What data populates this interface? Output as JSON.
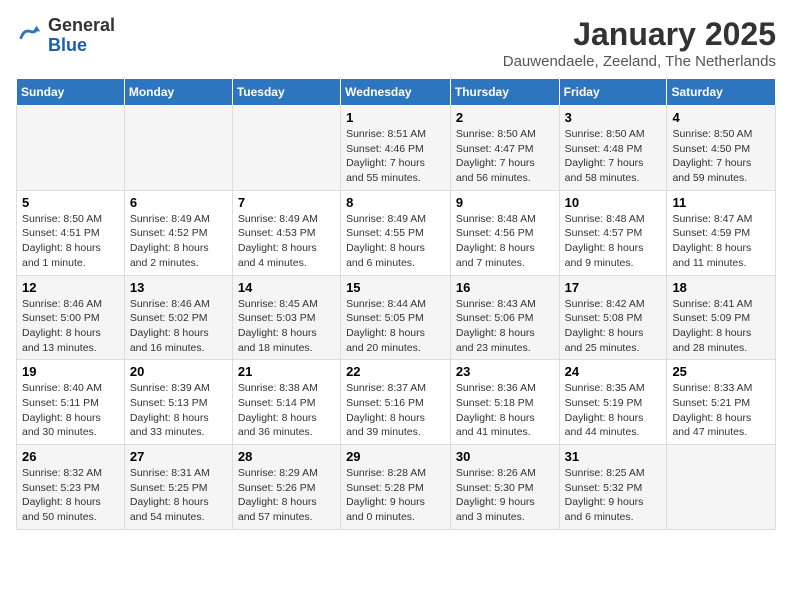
{
  "logo": {
    "general": "General",
    "blue": "Blue"
  },
  "title": "January 2025",
  "subtitle": "Dauwendaele, Zeeland, The Netherlands",
  "days_of_week": [
    "Sunday",
    "Monday",
    "Tuesday",
    "Wednesday",
    "Thursday",
    "Friday",
    "Saturday"
  ],
  "weeks": [
    [
      {
        "num": "",
        "text": ""
      },
      {
        "num": "",
        "text": ""
      },
      {
        "num": "",
        "text": ""
      },
      {
        "num": "1",
        "text": "Sunrise: 8:51 AM\nSunset: 4:46 PM\nDaylight: 7 hours and 55 minutes."
      },
      {
        "num": "2",
        "text": "Sunrise: 8:50 AM\nSunset: 4:47 PM\nDaylight: 7 hours and 56 minutes."
      },
      {
        "num": "3",
        "text": "Sunrise: 8:50 AM\nSunset: 4:48 PM\nDaylight: 7 hours and 58 minutes."
      },
      {
        "num": "4",
        "text": "Sunrise: 8:50 AM\nSunset: 4:50 PM\nDaylight: 7 hours and 59 minutes."
      }
    ],
    [
      {
        "num": "5",
        "text": "Sunrise: 8:50 AM\nSunset: 4:51 PM\nDaylight: 8 hours and 1 minute."
      },
      {
        "num": "6",
        "text": "Sunrise: 8:49 AM\nSunset: 4:52 PM\nDaylight: 8 hours and 2 minutes."
      },
      {
        "num": "7",
        "text": "Sunrise: 8:49 AM\nSunset: 4:53 PM\nDaylight: 8 hours and 4 minutes."
      },
      {
        "num": "8",
        "text": "Sunrise: 8:49 AM\nSunset: 4:55 PM\nDaylight: 8 hours and 6 minutes."
      },
      {
        "num": "9",
        "text": "Sunrise: 8:48 AM\nSunset: 4:56 PM\nDaylight: 8 hours and 7 minutes."
      },
      {
        "num": "10",
        "text": "Sunrise: 8:48 AM\nSunset: 4:57 PM\nDaylight: 8 hours and 9 minutes."
      },
      {
        "num": "11",
        "text": "Sunrise: 8:47 AM\nSunset: 4:59 PM\nDaylight: 8 hours and 11 minutes."
      }
    ],
    [
      {
        "num": "12",
        "text": "Sunrise: 8:46 AM\nSunset: 5:00 PM\nDaylight: 8 hours and 13 minutes."
      },
      {
        "num": "13",
        "text": "Sunrise: 8:46 AM\nSunset: 5:02 PM\nDaylight: 8 hours and 16 minutes."
      },
      {
        "num": "14",
        "text": "Sunrise: 8:45 AM\nSunset: 5:03 PM\nDaylight: 8 hours and 18 minutes."
      },
      {
        "num": "15",
        "text": "Sunrise: 8:44 AM\nSunset: 5:05 PM\nDaylight: 8 hours and 20 minutes."
      },
      {
        "num": "16",
        "text": "Sunrise: 8:43 AM\nSunset: 5:06 PM\nDaylight: 8 hours and 23 minutes."
      },
      {
        "num": "17",
        "text": "Sunrise: 8:42 AM\nSunset: 5:08 PM\nDaylight: 8 hours and 25 minutes."
      },
      {
        "num": "18",
        "text": "Sunrise: 8:41 AM\nSunset: 5:09 PM\nDaylight: 8 hours and 28 minutes."
      }
    ],
    [
      {
        "num": "19",
        "text": "Sunrise: 8:40 AM\nSunset: 5:11 PM\nDaylight: 8 hours and 30 minutes."
      },
      {
        "num": "20",
        "text": "Sunrise: 8:39 AM\nSunset: 5:13 PM\nDaylight: 8 hours and 33 minutes."
      },
      {
        "num": "21",
        "text": "Sunrise: 8:38 AM\nSunset: 5:14 PM\nDaylight: 8 hours and 36 minutes."
      },
      {
        "num": "22",
        "text": "Sunrise: 8:37 AM\nSunset: 5:16 PM\nDaylight: 8 hours and 39 minutes."
      },
      {
        "num": "23",
        "text": "Sunrise: 8:36 AM\nSunset: 5:18 PM\nDaylight: 8 hours and 41 minutes."
      },
      {
        "num": "24",
        "text": "Sunrise: 8:35 AM\nSunset: 5:19 PM\nDaylight: 8 hours and 44 minutes."
      },
      {
        "num": "25",
        "text": "Sunrise: 8:33 AM\nSunset: 5:21 PM\nDaylight: 8 hours and 47 minutes."
      }
    ],
    [
      {
        "num": "26",
        "text": "Sunrise: 8:32 AM\nSunset: 5:23 PM\nDaylight: 8 hours and 50 minutes."
      },
      {
        "num": "27",
        "text": "Sunrise: 8:31 AM\nSunset: 5:25 PM\nDaylight: 8 hours and 54 minutes."
      },
      {
        "num": "28",
        "text": "Sunrise: 8:29 AM\nSunset: 5:26 PM\nDaylight: 8 hours and 57 minutes."
      },
      {
        "num": "29",
        "text": "Sunrise: 8:28 AM\nSunset: 5:28 PM\nDaylight: 9 hours and 0 minutes."
      },
      {
        "num": "30",
        "text": "Sunrise: 8:26 AM\nSunset: 5:30 PM\nDaylight: 9 hours and 3 minutes."
      },
      {
        "num": "31",
        "text": "Sunrise: 8:25 AM\nSunset: 5:32 PM\nDaylight: 9 hours and 6 minutes."
      },
      {
        "num": "",
        "text": ""
      }
    ]
  ]
}
